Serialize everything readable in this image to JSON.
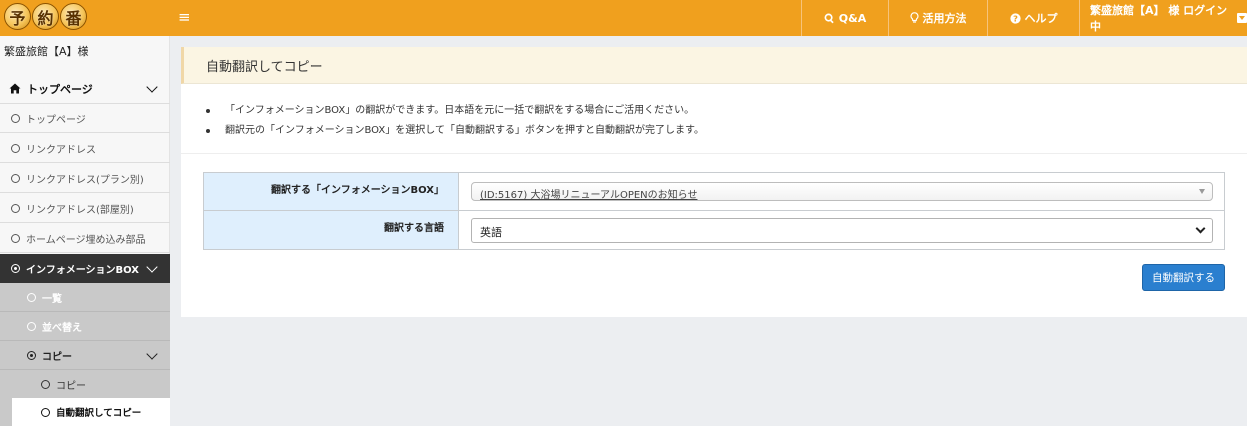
{
  "header": {
    "logo_chars": [
      "予",
      "約",
      "番"
    ],
    "menu_icon": "≡",
    "nav": {
      "qa": "Q&A",
      "howto": "活用方法",
      "help": "ヘルプ",
      "user": "繁盛旅館【A】 様 ログイン中"
    },
    "accent_color": "#f0a01e"
  },
  "sidebar": {
    "hotel_name": "繁盛旅館【A】様",
    "top_section": "トップページ",
    "links": [
      "トップページ",
      "リンクアドレス",
      "リンクアドレス(プラン別)",
      "リンクアドレス(部屋別)",
      "ホームページ埋め込み部品"
    ],
    "active_section": "インフォメーションBOX",
    "sub_items": [
      "一覧",
      "並べ替え"
    ],
    "copy_section": "コピー",
    "copy_items": [
      "コピー",
      "自動翻訳してコピー"
    ]
  },
  "main": {
    "page_title": "自動翻訳してコピー",
    "notes": [
      "「インフォメーションBOX」の翻訳ができます。日本語を元に一括で翻訳をする場合にご活用ください。",
      "翻訳元の「インフォメーションBOX」を選択して「自動翻訳する」ボタンを押すと自動翻訳が完了します。"
    ],
    "form": {
      "source_label": "翻訳する「インフォメーションBOX」",
      "source_value": "(ID:5167) 大浴場リニューアルOPENのお知らせ",
      "language_label": "翻訳する言語",
      "language_value": "英語"
    },
    "submit_label": "自動翻訳する"
  }
}
